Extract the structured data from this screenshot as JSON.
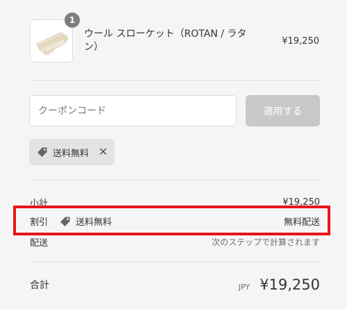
{
  "product": {
    "quantity": "1",
    "name": "ウール スローケット（ROTAN / ラタン）",
    "price": "¥19,250",
    "image": "throw-blanket-thumbnail"
  },
  "coupon": {
    "placeholder": "クーポンコード",
    "value": "",
    "apply_label": "適用する"
  },
  "applied_discount": {
    "label": "送料無料",
    "icon": "tag-icon",
    "remove_icon": "close-icon"
  },
  "summary": {
    "subtotal_label": "小計",
    "subtotal_value": "¥19,250",
    "discount_label": "割引",
    "discount_code": "送料無料",
    "discount_value": "無料配送",
    "shipping_label": "配送",
    "shipping_value": "次のステップで計算されます",
    "total_label": "合計",
    "total_currency": "JPY",
    "total_value": "¥19,250"
  },
  "colors": {
    "highlight": "#e8141b",
    "apply_button": "#c8c8c8",
    "badge": "#7f7f7f"
  }
}
